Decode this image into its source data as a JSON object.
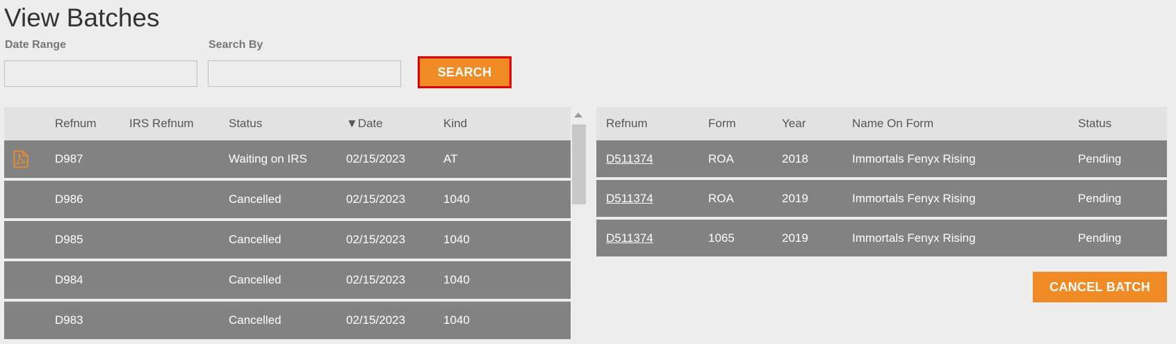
{
  "page": {
    "title": "View Batches"
  },
  "filters": {
    "date_range_label": "Date Range",
    "date_range_value": "",
    "search_by_label": "Search By",
    "search_by_value": "",
    "search_button": "SEARCH"
  },
  "batches": {
    "headers": {
      "refnum": "Refnum",
      "irs_refnum": "IRS Refnum",
      "status": "Status",
      "date": "▼Date",
      "kind": "Kind"
    },
    "rows": [
      {
        "icon": "pdf-icon",
        "refnum": "D987",
        "irs_refnum": "",
        "status": "Waiting on IRS",
        "date": "02/15/2023",
        "kind": "AT"
      },
      {
        "refnum": "D986",
        "irs_refnum": "",
        "status": "Cancelled",
        "date": "02/15/2023",
        "kind": "1040"
      },
      {
        "refnum": "D985",
        "irs_refnum": "",
        "status": "Cancelled",
        "date": "02/15/2023",
        "kind": "1040"
      },
      {
        "refnum": "D984",
        "irs_refnum": "",
        "status": "Cancelled",
        "date": "02/15/2023",
        "kind": "1040"
      },
      {
        "refnum": "D983",
        "irs_refnum": "",
        "status": "Cancelled",
        "date": "02/15/2023",
        "kind": "1040"
      }
    ]
  },
  "batch_detail": {
    "headers": {
      "refnum": "Refnum",
      "form": "Form",
      "year": "Year",
      "name": "Name On Form",
      "status": "Status"
    },
    "rows": [
      {
        "refnum": "D511374",
        "form": "ROA",
        "year": "2018",
        "name": "Immortals Fenyx Rising",
        "status": "Pending"
      },
      {
        "refnum": "D511374",
        "form": "ROA",
        "year": "2019",
        "name": "Immortals Fenyx Rising",
        "status": "Pending"
      },
      {
        "refnum": "D511374",
        "form": "1065",
        "year": "2019",
        "name": "Immortals Fenyx Rising",
        "status": "Pending"
      }
    ],
    "cancel_button": "CANCEL BATCH"
  },
  "colors": {
    "accent": "#f08a24",
    "row_bg": "#828282",
    "header_bg": "#e2e2e2",
    "focus_border": "#e00000"
  }
}
